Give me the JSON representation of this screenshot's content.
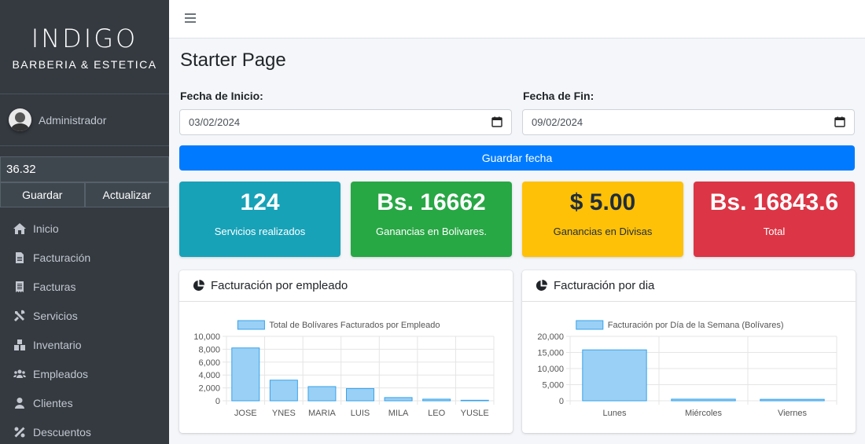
{
  "sidebar": {
    "brand_logo": "INDIGO",
    "brand_sub": "BARBERIA & ESTETICA",
    "user_name": "Administrador",
    "rate_value": "36.32",
    "save_label": "Guardar",
    "update_label": "Actualizar",
    "items": [
      {
        "label": "Inicio",
        "icon": "home-icon"
      },
      {
        "label": "Facturación",
        "icon": "file-invoice-icon"
      },
      {
        "label": "Facturas",
        "icon": "receipt-icon"
      },
      {
        "label": "Servicios",
        "icon": "tools-icon"
      },
      {
        "label": "Inventario",
        "icon": "boxes-icon"
      },
      {
        "label": "Empleados",
        "icon": "users-icon"
      },
      {
        "label": "Clientes",
        "icon": "user-icon"
      },
      {
        "label": "Descuentos",
        "icon": "percent-icon"
      }
    ]
  },
  "main": {
    "title": "Starter Page",
    "start_label": "Fecha de Inicio:",
    "start_value": "03/02/2024",
    "end_label": "Fecha de Fin:",
    "end_value": "09/02/2024",
    "save_date_label": "Guardar fecha",
    "stats": [
      {
        "value": "124",
        "label": "Servicios realizados",
        "color": "#17a2b8"
      },
      {
        "value": "Bs. 16662",
        "label": "Ganancias en Bolivares.",
        "color": "#28a745"
      },
      {
        "value": "$ 5.00",
        "label": "Ganancias en Divisas",
        "color": "#ffc107"
      },
      {
        "value": "Bs. 16843.6",
        "label": "Total",
        "color": "#dc3545"
      }
    ],
    "card_employee_title": "Facturación por empleado",
    "card_day_title": "Facturación por dia"
  },
  "chart_data": [
    {
      "type": "bar",
      "legend": "Total de Bolívares Facturados por Empleado",
      "categories": [
        "JOSE",
        "YNES",
        "MARIA",
        "LUIS",
        "MILA",
        "LEO",
        "YUSLE"
      ],
      "values": [
        8200,
        3200,
        2200,
        1900,
        500,
        250,
        80
      ],
      "ylim": [
        0,
        10000
      ],
      "yticks": [
        0,
        2000,
        4000,
        6000,
        8000,
        10000
      ],
      "ytick_labels": [
        "0",
        "2,000",
        "4,000",
        "6,000",
        "8,000",
        "10,000"
      ],
      "grid": true,
      "legend_position": "top"
    },
    {
      "type": "bar",
      "legend": "Facturación por Día de la Semana (Bolívares)",
      "categories": [
        "Lunes",
        "Miércoles",
        "Viernes"
      ],
      "values": [
        15800,
        500,
        450
      ],
      "ylim": [
        0,
        20000
      ],
      "yticks": [
        0,
        5000,
        10000,
        15000,
        20000
      ],
      "ytick_labels": [
        "0",
        "5,000",
        "10,000",
        "15,000",
        "20,000"
      ],
      "grid": true,
      "legend_position": "top"
    }
  ]
}
